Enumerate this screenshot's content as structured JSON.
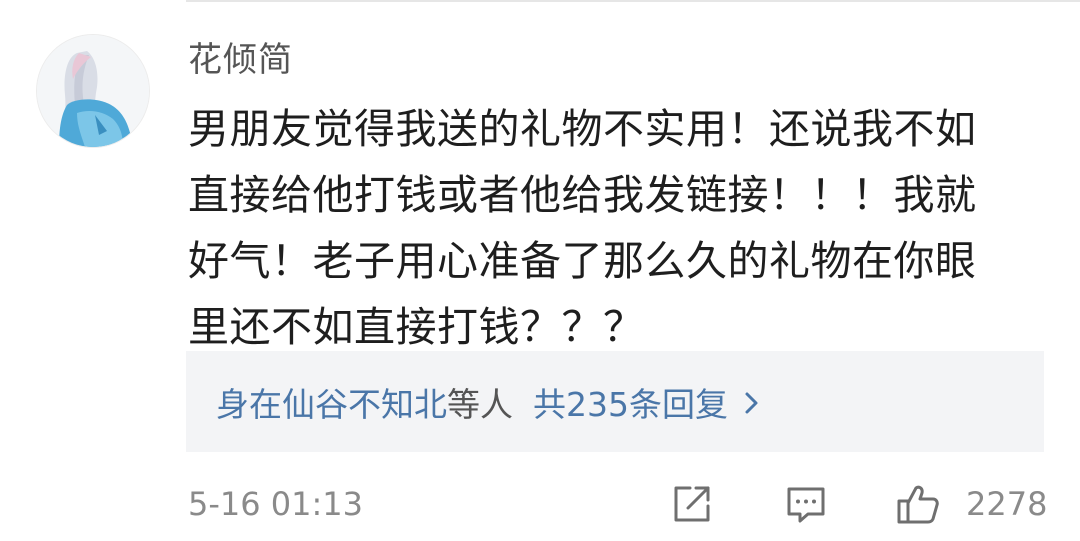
{
  "comment": {
    "username": "花倾简",
    "avatar_icon": "avatar-anime-girl",
    "body_lines": [
      "男朋友觉得我送的礼物不实用！还说我不如",
      "直接给他打钱或者他给我发链接！！！我就",
      "好气！老子用心准备了那么久的礼物在你眼",
      "里还不如直接打钱？？？"
    ],
    "replies": {
      "names": "身在仙谷不知北",
      "suffix": "等人",
      "count_text": "共235条回复",
      "chevron_icon": "chevron-right-icon"
    },
    "timestamp": "5-16 01:13",
    "actions": {
      "share_icon": "share-icon",
      "reply_icon": "reply-icon",
      "like_icon": "thumbs-up-icon",
      "like_count": "2278"
    }
  },
  "colors": {
    "link": "#4a76a8",
    "text": "#1e1e1e",
    "meta": "#8a8a8a",
    "replies_bg": "#f3f4f6"
  }
}
